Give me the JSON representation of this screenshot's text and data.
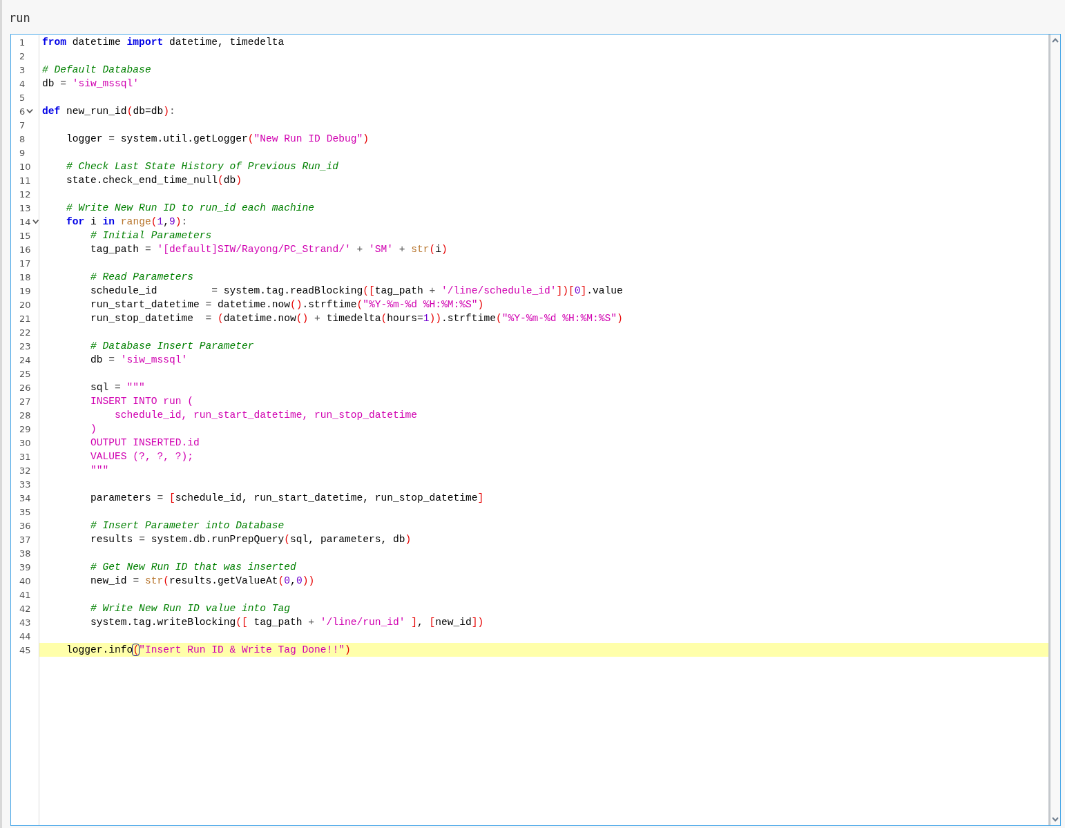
{
  "title": "run",
  "lines": [
    {
      "number": "1",
      "tokens": [
        {
          "kind": "kw",
          "text": "from"
        },
        {
          "kind": "p",
          "text": " datetime "
        },
        {
          "kind": "kw",
          "text": "import"
        },
        {
          "kind": "p",
          "text": " datetime, timedelta"
        }
      ]
    },
    {
      "number": "2"
    },
    {
      "number": "3",
      "tokens": [
        {
          "kind": "c",
          "text": "# Default Database"
        }
      ]
    },
    {
      "number": "4",
      "tokens": [
        {
          "kind": "p",
          "text": "db "
        },
        {
          "kind": "o",
          "text": "= "
        },
        {
          "kind": "s",
          "text": "'siw_mssql'"
        }
      ]
    },
    {
      "number": "5"
    },
    {
      "number": "6",
      "expanded": true,
      "tokens": [
        {
          "kind": "kw",
          "text": "def"
        },
        {
          "kind": "p",
          "text": " new_run_id"
        },
        {
          "kind": "b",
          "text": "("
        },
        {
          "kind": "p",
          "text": "db"
        },
        {
          "kind": "o",
          "text": "="
        },
        {
          "kind": "p",
          "text": "db"
        },
        {
          "kind": "b",
          "text": ")"
        },
        {
          "kind": "o",
          "text": ":"
        }
      ]
    },
    {
      "number": "7"
    },
    {
      "number": "8",
      "tokens": [
        {
          "kind": "p",
          "text": "    logger "
        },
        {
          "kind": "o",
          "text": "="
        },
        {
          "kind": "p",
          "text": " system.util.getLogger"
        },
        {
          "kind": "b",
          "text": "("
        },
        {
          "kind": "s",
          "text": "\"New Run ID Debug\""
        },
        {
          "kind": "b",
          "text": ")"
        }
      ]
    },
    {
      "number": "9"
    },
    {
      "number": "10",
      "tokens": [
        {
          "kind": "c",
          "text": "    # Check Last State History of Previous Run_id"
        }
      ]
    },
    {
      "number": "11",
      "tokens": [
        {
          "kind": "p",
          "text": "    state.check_end_time_null"
        },
        {
          "kind": "b",
          "text": "("
        },
        {
          "kind": "p",
          "text": "db"
        },
        {
          "kind": "b",
          "text": ")"
        }
      ]
    },
    {
      "number": "12"
    },
    {
      "number": "13",
      "tokens": [
        {
          "kind": "c",
          "text": "    # Write New Run ID to run_id each machine"
        }
      ]
    },
    {
      "number": "14",
      "expanded": true,
      "tokens": [
        {
          "kind": "kw",
          "text": "    for"
        },
        {
          "kind": "p",
          "text": " i "
        },
        {
          "kind": "kw",
          "text": "in"
        },
        {
          "kind": "f",
          "text": " range"
        },
        {
          "kind": "b",
          "text": "("
        },
        {
          "kind": "n",
          "text": "1"
        },
        {
          "kind": "p",
          "text": ","
        },
        {
          "kind": "n",
          "text": "9"
        },
        {
          "kind": "b",
          "text": ")"
        },
        {
          "kind": "o",
          "text": ":"
        }
      ]
    },
    {
      "number": "15",
      "tokens": [
        {
          "kind": "c",
          "text": "        # Initial Parameters"
        }
      ]
    },
    {
      "number": "16",
      "tokens": [
        {
          "kind": "p",
          "text": "        tag_path "
        },
        {
          "kind": "o",
          "text": "= "
        },
        {
          "kind": "s",
          "text": "'[default]SIW/Rayong/PC_Strand/'"
        },
        {
          "kind": "o",
          "text": " + "
        },
        {
          "kind": "s",
          "text": "'SM'"
        },
        {
          "kind": "o",
          "text": " + "
        },
        {
          "kind": "f",
          "text": "str"
        },
        {
          "kind": "b",
          "text": "("
        },
        {
          "kind": "p",
          "text": "i"
        },
        {
          "kind": "b",
          "text": ")"
        }
      ]
    },
    {
      "number": "17"
    },
    {
      "number": "18",
      "tokens": [
        {
          "kind": "c",
          "text": "        # Read Parameters"
        }
      ]
    },
    {
      "number": "19",
      "tokens": [
        {
          "kind": "p",
          "text": "        schedule_id         "
        },
        {
          "kind": "o",
          "text": "="
        },
        {
          "kind": "p",
          "text": " system.tag.readBlocking"
        },
        {
          "kind": "b",
          "text": "(["
        },
        {
          "kind": "p",
          "text": "tag_path "
        },
        {
          "kind": "o",
          "text": "+ "
        },
        {
          "kind": "s",
          "text": "'/line/schedule_id'"
        },
        {
          "kind": "b",
          "text": "])["
        },
        {
          "kind": "n",
          "text": "0"
        },
        {
          "kind": "b",
          "text": "]"
        },
        {
          "kind": "p",
          "text": ".value"
        }
      ]
    },
    {
      "number": "20",
      "tokens": [
        {
          "kind": "p",
          "text": "        run_start_datetime "
        },
        {
          "kind": "o",
          "text": "="
        },
        {
          "kind": "p",
          "text": " datetime.now"
        },
        {
          "kind": "b",
          "text": "()"
        },
        {
          "kind": "p",
          "text": ".strftime"
        },
        {
          "kind": "b",
          "text": "("
        },
        {
          "kind": "s",
          "text": "\"%Y-%m-%d %H:%M:%S\""
        },
        {
          "kind": "b",
          "text": ")"
        }
      ]
    },
    {
      "number": "21",
      "tokens": [
        {
          "kind": "p",
          "text": "        run_stop_datetime  "
        },
        {
          "kind": "o",
          "text": "= "
        },
        {
          "kind": "b",
          "text": "("
        },
        {
          "kind": "p",
          "text": "datetime.now"
        },
        {
          "kind": "b",
          "text": "()"
        },
        {
          "kind": "o",
          "text": " + "
        },
        {
          "kind": "p",
          "text": "timedelta"
        },
        {
          "kind": "b",
          "text": "("
        },
        {
          "kind": "p",
          "text": "hours"
        },
        {
          "kind": "o",
          "text": "="
        },
        {
          "kind": "n",
          "text": "1"
        },
        {
          "kind": "b",
          "text": "))"
        },
        {
          "kind": "p",
          "text": ".strftime"
        },
        {
          "kind": "b",
          "text": "("
        },
        {
          "kind": "s",
          "text": "\"%Y-%m-%d %H:%M:%S\""
        },
        {
          "kind": "b",
          "text": ")"
        }
      ]
    },
    {
      "number": "22"
    },
    {
      "number": "23",
      "tokens": [
        {
          "kind": "c",
          "text": "        # Database Insert Parameter"
        }
      ]
    },
    {
      "number": "24",
      "tokens": [
        {
          "kind": "p",
          "text": "        db "
        },
        {
          "kind": "o",
          "text": "= "
        },
        {
          "kind": "s",
          "text": "'siw_mssql'"
        }
      ]
    },
    {
      "number": "25"
    },
    {
      "number": "26",
      "tokens": [
        {
          "kind": "p",
          "text": "        sql "
        },
        {
          "kind": "o",
          "text": "= "
        },
        {
          "kind": "s",
          "text": "\"\"\""
        }
      ]
    },
    {
      "number": "27",
      "tokens": [
        {
          "kind": "s",
          "text": "        INSERT INTO run ("
        }
      ]
    },
    {
      "number": "28",
      "tokens": [
        {
          "kind": "s",
          "text": "            schedule_id, run_start_datetime, run_stop_datetime"
        }
      ]
    },
    {
      "number": "29",
      "tokens": [
        {
          "kind": "s",
          "text": "        )"
        }
      ]
    },
    {
      "number": "30",
      "tokens": [
        {
          "kind": "s",
          "text": "        OUTPUT INSERTED.id"
        }
      ]
    },
    {
      "number": "31",
      "tokens": [
        {
          "kind": "s",
          "text": "        VALUES (?, ?, ?);"
        }
      ]
    },
    {
      "number": "32",
      "tokens": [
        {
          "kind": "s",
          "text": "        \"\"\""
        }
      ]
    },
    {
      "number": "33"
    },
    {
      "number": "34",
      "tokens": [
        {
          "kind": "p",
          "text": "        parameters "
        },
        {
          "kind": "o",
          "text": "= "
        },
        {
          "kind": "b",
          "text": "["
        },
        {
          "kind": "p",
          "text": "schedule_id, run_start_datetime, run_stop_datetime"
        },
        {
          "kind": "b",
          "text": "]"
        }
      ]
    },
    {
      "number": "35"
    },
    {
      "number": "36",
      "tokens": [
        {
          "kind": "c",
          "text": "        # Insert Parameter into Database"
        }
      ]
    },
    {
      "number": "37",
      "tokens": [
        {
          "kind": "p",
          "text": "        results "
        },
        {
          "kind": "o",
          "text": "="
        },
        {
          "kind": "p",
          "text": " system.db.runPrepQuery"
        },
        {
          "kind": "b",
          "text": "("
        },
        {
          "kind": "p",
          "text": "sql, parameters, db"
        },
        {
          "kind": "b",
          "text": ")"
        }
      ]
    },
    {
      "number": "38"
    },
    {
      "number": "39",
      "tokens": [
        {
          "kind": "c",
          "text": "        # Get New Run ID that was inserted"
        }
      ]
    },
    {
      "number": "40",
      "tokens": [
        {
          "kind": "p",
          "text": "        new_id "
        },
        {
          "kind": "o",
          "text": "= "
        },
        {
          "kind": "f",
          "text": "str"
        },
        {
          "kind": "b",
          "text": "("
        },
        {
          "kind": "p",
          "text": "results.getValueAt"
        },
        {
          "kind": "b",
          "text": "("
        },
        {
          "kind": "n",
          "text": "0"
        },
        {
          "kind": "p",
          "text": ","
        },
        {
          "kind": "n",
          "text": "0"
        },
        {
          "kind": "b",
          "text": "))"
        }
      ]
    },
    {
      "number": "41"
    },
    {
      "number": "42",
      "tokens": [
        {
          "kind": "c",
          "text": "        # Write New Run ID value into Tag"
        }
      ]
    },
    {
      "number": "43",
      "tokens": [
        {
          "kind": "p",
          "text": "        system.tag.writeBlocking"
        },
        {
          "kind": "b",
          "text": "(["
        },
        {
          "kind": "p",
          "text": " tag_path "
        },
        {
          "kind": "o",
          "text": "+ "
        },
        {
          "kind": "s",
          "text": "'/line/run_id'"
        },
        {
          "kind": "b",
          "text": " ]"
        },
        {
          "kind": "p",
          "text": ", "
        },
        {
          "kind": "b",
          "text": "["
        },
        {
          "kind": "p",
          "text": "new_id"
        },
        {
          "kind": "b",
          "text": "])"
        }
      ]
    },
    {
      "number": "44"
    },
    {
      "number": "45",
      "current": true,
      "tokens": [
        {
          "kind": "p",
          "text": "    logger.info"
        },
        {
          "kind": "b",
          "text": "(",
          "cursor": true
        },
        {
          "kind": "s",
          "text": "\"Insert Run ID & Write Tag Done!!\""
        },
        {
          "kind": "b",
          "text": ")"
        }
      ]
    }
  ]
}
